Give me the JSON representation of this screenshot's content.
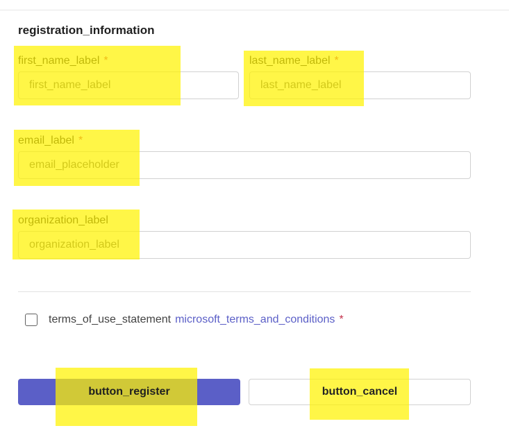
{
  "form": {
    "section_title": "registration_information",
    "required_marker": "*",
    "fields": {
      "first_name": {
        "label": "first_name_label",
        "placeholder": "first_name_label"
      },
      "last_name": {
        "label": "last_name_label",
        "placeholder": "last_name_label"
      },
      "email": {
        "label": "email_label",
        "placeholder": "email_placeholder"
      },
      "organization": {
        "label": "organization_label",
        "placeholder": "organization_label"
      }
    },
    "terms": {
      "statement": "terms_of_use_statement",
      "link": "microsoft_terms_and_conditions"
    },
    "buttons": {
      "register": "button_register",
      "cancel": "button_cancel"
    }
  },
  "colors": {
    "accent": "#5b5fc7",
    "required": "#c4314b",
    "highlight": "#fff200"
  }
}
